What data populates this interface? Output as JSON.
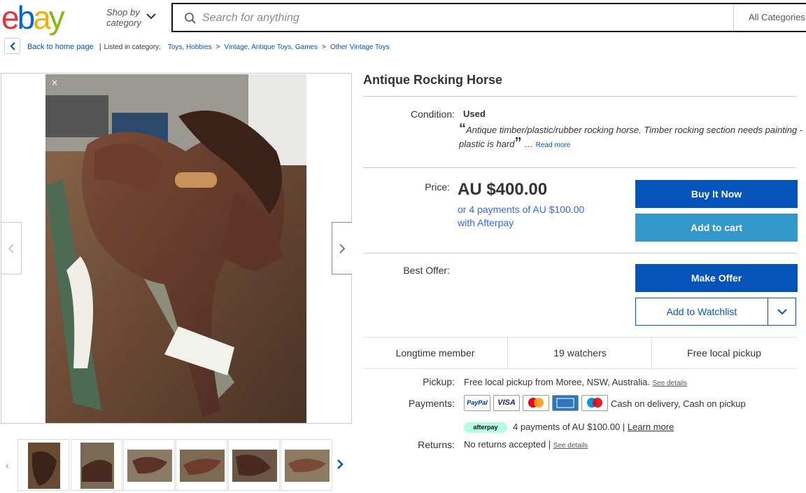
{
  "header": {
    "logo": [
      "e",
      "b",
      "a",
      "y"
    ],
    "shop_by_category": [
      "Shop by",
      "category"
    ],
    "search_placeholder": "Search for anything",
    "all_categories": "All Categories"
  },
  "breadcrumb": {
    "back": "Back to home page",
    "listed_in": "Listed in category:",
    "crumbs": [
      "Toys, Hobbies",
      "Vintage, Antique Toys, Games",
      "Other Vintage Toys"
    ]
  },
  "listing": {
    "title": "Antique Rocking Horse",
    "condition_label": "Condition:",
    "condition_value": "Used",
    "condition_desc": "Antique timber/plastic/rubber rocking horse. Timber rocking section needs painting - plastic is hard",
    "read_more": "Read more",
    "price_label": "Price:",
    "price": "AU $400.00",
    "afterpay_line1": "or 4 payments of AU $100.00",
    "afterpay_line2": "with Afterpay",
    "buy_now": "Buy It Now",
    "add_to_cart": "Add to cart",
    "best_offer_label": "Best Offer:",
    "make_offer": "Make Offer",
    "add_to_watchlist": "Add to Watchlist",
    "stats": [
      "Longtime member",
      "19 watchers",
      "Free local pickup"
    ],
    "pickup_label": "Pickup:",
    "pickup_value": "Free local pickup from Moree, NSW, Australia.",
    "see_details": "See details",
    "payments_label": "Payments:",
    "payment_methods": [
      "PayPal",
      "VISA",
      "Mastercard",
      "American Express",
      "Maestro"
    ],
    "payments_extra": "Cash on delivery, Cash on pickup",
    "afterpay_badge": "afterpay",
    "afterpay_installments": "4 payments of AU $100.00",
    "learn_more": "Learn more",
    "returns_label": "Returns:",
    "returns_value": "No returns accepted",
    "returns_see_details": "See details"
  },
  "gallery": {
    "thumbnail_count": 6
  },
  "colors": {
    "primary_blue": "#0654ba",
    "cart_blue": "#3498ca",
    "link_blue": "#3665f3",
    "afterpay_mint": "#b2fce4"
  }
}
